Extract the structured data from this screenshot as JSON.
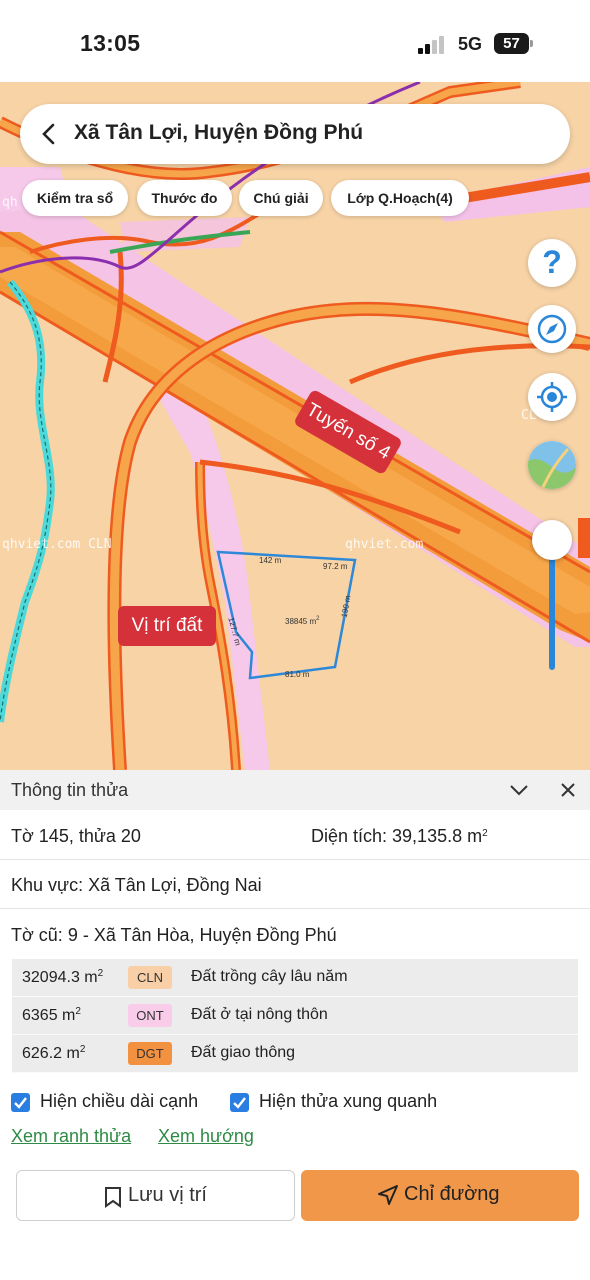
{
  "status_bar": {
    "time": "13:05",
    "network": "5G",
    "battery": "57",
    "signal_bars": 2
  },
  "map": {
    "title": "Xã Tân Lợi, Huyện Đồng Phú",
    "chips": [
      "Kiểm tra sổ",
      "Thước đo",
      "Chú giải",
      "Lớp Q.Hoạch(4)"
    ],
    "road_label": "Tuyến số 4",
    "location_label": "Vị trí đất",
    "watermarks": [
      "qhviet.com",
      "CLN",
      "qhviet.com",
      "qh",
      "CL"
    ],
    "parcel": {
      "area_label": "38845 m",
      "edges": [
        "142 m",
        "97.2 m",
        "190 m",
        "81.0 m",
        "127.7 m"
      ]
    },
    "buttons": {
      "help_glyph": "?"
    },
    "zoom_level": 0.85
  },
  "panel": {
    "title": "Thông tin thửa",
    "sheet": "Tờ 145, thửa 20",
    "area_label": "Diện tích: 39,135.8 m",
    "region": "Khu vực: Xã Tân Lợi, Đồng Nai",
    "old_sheet": "Tờ cũ: 9 - Xã Tân Hòa, Huyện Đồng Phú",
    "square_exp": "2",
    "land_uses": [
      {
        "area": "32094.3 m",
        "code": "CLN",
        "color": "#f8cfa6",
        "desc": "Đất trồng cây lâu năm"
      },
      {
        "area": "6365 m",
        "code": "ONT",
        "color": "#f9cdea",
        "desc": "Đất ở tại nông thôn"
      },
      {
        "area": "626.2 m",
        "code": "DGT",
        "color": "#f29240",
        "desc": "Đất giao thông"
      }
    ],
    "checkboxes": [
      {
        "label": "Hiện chiều dài cạnh",
        "checked": true
      },
      {
        "label": "Hiện thửa xung quanh",
        "checked": true
      }
    ],
    "links": [
      "Xem ranh thửa",
      "Xem hướng"
    ],
    "save_button": "Lưu vị trí",
    "route_button": "Chỉ đường"
  },
  "colors": {
    "accent_blue": "#2a7de1",
    "route_orange": "#f0974a",
    "link_green": "#2e8a44",
    "label_red": "#d5313a"
  }
}
